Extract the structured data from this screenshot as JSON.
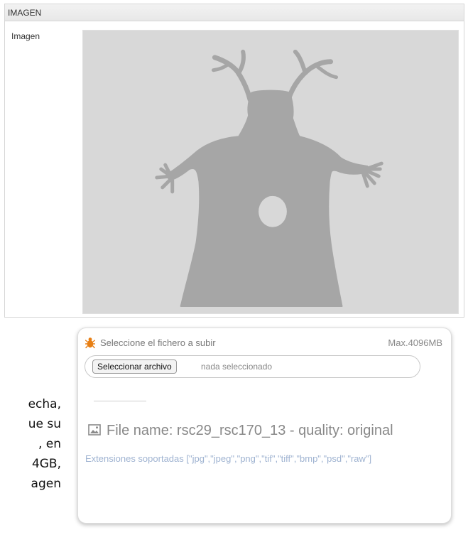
{
  "section": {
    "header": "IMAGEN",
    "field_label": "Imagen"
  },
  "side_text": [
    "echa,",
    "ue su",
    ",  en",
    "4GB,",
    "agen"
  ],
  "upload": {
    "prompt": "Seleccione el fichero a subir",
    "max_size": "Max.4096MB",
    "choose_button": "Seleccionar archivo",
    "file_status": "nada seleccionado",
    "file_name": "File name: rsc29_rsc170_13 - quality: original",
    "extensions": "Extensiones soportadas [\"jpg\",\"jpeg\",\"png\",\"tif\",\"tiff\",\"bmp\",\"psd\",\"raw\"]"
  },
  "colors": {
    "image_background": "#d8d8d8",
    "figure": "#a6a6a6",
    "bug_icon": "#e87f14",
    "extensions_text": "#9fb3d1"
  },
  "icons": [
    "bug-icon",
    "image-icon"
  ]
}
